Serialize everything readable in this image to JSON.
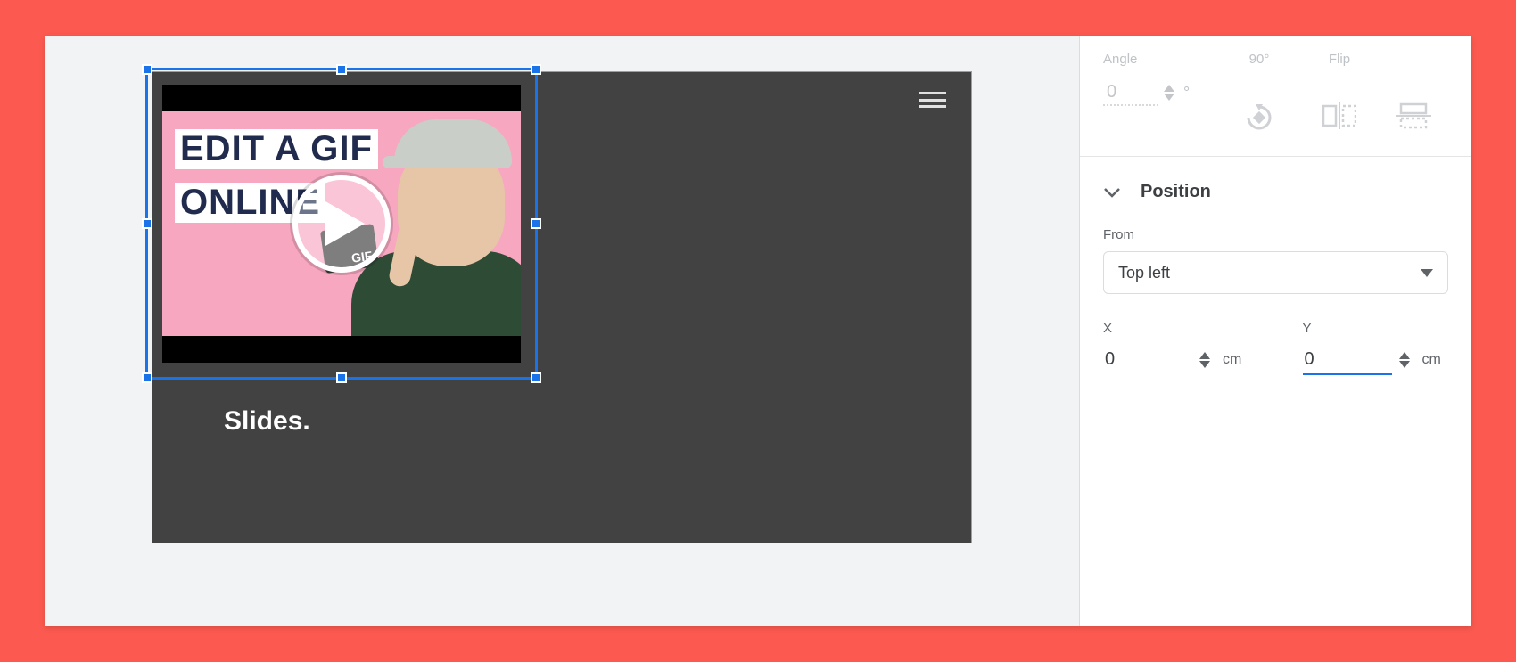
{
  "slide": {
    "visible_text": "Slides.",
    "thumbnail": {
      "line1": "EDIT A GIF",
      "line2": "ONLINE",
      "chip": "GIF"
    }
  },
  "sidebar": {
    "rotate": {
      "angle_label": "Angle",
      "angle_value": "0",
      "ninety_label": "90°",
      "flip_label": "Flip"
    },
    "position": {
      "section_title": "Position",
      "from_label": "From",
      "from_value": "Top left",
      "x_label": "X",
      "x_value": "0",
      "x_unit": "cm",
      "y_label": "Y",
      "y_value": "0",
      "y_unit": "cm"
    }
  }
}
